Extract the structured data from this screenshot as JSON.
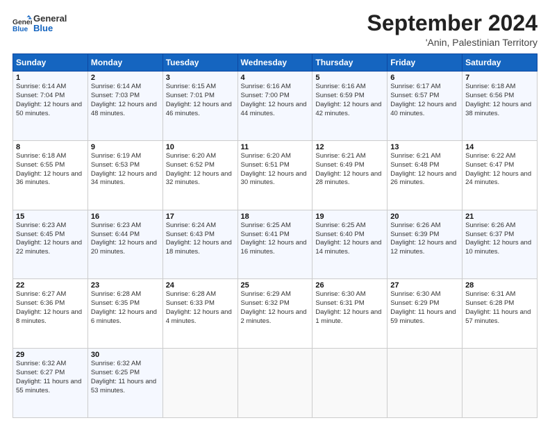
{
  "header": {
    "logo_line1": "General",
    "logo_line2": "Blue",
    "month": "September 2024",
    "location": "'Anin, Palestinian Territory"
  },
  "weekdays": [
    "Sunday",
    "Monday",
    "Tuesday",
    "Wednesday",
    "Thursday",
    "Friday",
    "Saturday"
  ],
  "weeks": [
    [
      {
        "day": "1",
        "sunrise": "Sunrise: 6:14 AM",
        "sunset": "Sunset: 7:04 PM",
        "daylight": "Daylight: 12 hours and 50 minutes."
      },
      {
        "day": "2",
        "sunrise": "Sunrise: 6:14 AM",
        "sunset": "Sunset: 7:03 PM",
        "daylight": "Daylight: 12 hours and 48 minutes."
      },
      {
        "day": "3",
        "sunrise": "Sunrise: 6:15 AM",
        "sunset": "Sunset: 7:01 PM",
        "daylight": "Daylight: 12 hours and 46 minutes."
      },
      {
        "day": "4",
        "sunrise": "Sunrise: 6:16 AM",
        "sunset": "Sunset: 7:00 PM",
        "daylight": "Daylight: 12 hours and 44 minutes."
      },
      {
        "day": "5",
        "sunrise": "Sunrise: 6:16 AM",
        "sunset": "Sunset: 6:59 PM",
        "daylight": "Daylight: 12 hours and 42 minutes."
      },
      {
        "day": "6",
        "sunrise": "Sunrise: 6:17 AM",
        "sunset": "Sunset: 6:57 PM",
        "daylight": "Daylight: 12 hours and 40 minutes."
      },
      {
        "day": "7",
        "sunrise": "Sunrise: 6:18 AM",
        "sunset": "Sunset: 6:56 PM",
        "daylight": "Daylight: 12 hours and 38 minutes."
      }
    ],
    [
      {
        "day": "8",
        "sunrise": "Sunrise: 6:18 AM",
        "sunset": "Sunset: 6:55 PM",
        "daylight": "Daylight: 12 hours and 36 minutes."
      },
      {
        "day": "9",
        "sunrise": "Sunrise: 6:19 AM",
        "sunset": "Sunset: 6:53 PM",
        "daylight": "Daylight: 12 hours and 34 minutes."
      },
      {
        "day": "10",
        "sunrise": "Sunrise: 6:20 AM",
        "sunset": "Sunset: 6:52 PM",
        "daylight": "Daylight: 12 hours and 32 minutes."
      },
      {
        "day": "11",
        "sunrise": "Sunrise: 6:20 AM",
        "sunset": "Sunset: 6:51 PM",
        "daylight": "Daylight: 12 hours and 30 minutes."
      },
      {
        "day": "12",
        "sunrise": "Sunrise: 6:21 AM",
        "sunset": "Sunset: 6:49 PM",
        "daylight": "Daylight: 12 hours and 28 minutes."
      },
      {
        "day": "13",
        "sunrise": "Sunrise: 6:21 AM",
        "sunset": "Sunset: 6:48 PM",
        "daylight": "Daylight: 12 hours and 26 minutes."
      },
      {
        "day": "14",
        "sunrise": "Sunrise: 6:22 AM",
        "sunset": "Sunset: 6:47 PM",
        "daylight": "Daylight: 12 hours and 24 minutes."
      }
    ],
    [
      {
        "day": "15",
        "sunrise": "Sunrise: 6:23 AM",
        "sunset": "Sunset: 6:45 PM",
        "daylight": "Daylight: 12 hours and 22 minutes."
      },
      {
        "day": "16",
        "sunrise": "Sunrise: 6:23 AM",
        "sunset": "Sunset: 6:44 PM",
        "daylight": "Daylight: 12 hours and 20 minutes."
      },
      {
        "day": "17",
        "sunrise": "Sunrise: 6:24 AM",
        "sunset": "Sunset: 6:43 PM",
        "daylight": "Daylight: 12 hours and 18 minutes."
      },
      {
        "day": "18",
        "sunrise": "Sunrise: 6:25 AM",
        "sunset": "Sunset: 6:41 PM",
        "daylight": "Daylight: 12 hours and 16 minutes."
      },
      {
        "day": "19",
        "sunrise": "Sunrise: 6:25 AM",
        "sunset": "Sunset: 6:40 PM",
        "daylight": "Daylight: 12 hours and 14 minutes."
      },
      {
        "day": "20",
        "sunrise": "Sunrise: 6:26 AM",
        "sunset": "Sunset: 6:39 PM",
        "daylight": "Daylight: 12 hours and 12 minutes."
      },
      {
        "day": "21",
        "sunrise": "Sunrise: 6:26 AM",
        "sunset": "Sunset: 6:37 PM",
        "daylight": "Daylight: 12 hours and 10 minutes."
      }
    ],
    [
      {
        "day": "22",
        "sunrise": "Sunrise: 6:27 AM",
        "sunset": "Sunset: 6:36 PM",
        "daylight": "Daylight: 12 hours and 8 minutes."
      },
      {
        "day": "23",
        "sunrise": "Sunrise: 6:28 AM",
        "sunset": "Sunset: 6:35 PM",
        "daylight": "Daylight: 12 hours and 6 minutes."
      },
      {
        "day": "24",
        "sunrise": "Sunrise: 6:28 AM",
        "sunset": "Sunset: 6:33 PM",
        "daylight": "Daylight: 12 hours and 4 minutes."
      },
      {
        "day": "25",
        "sunrise": "Sunrise: 6:29 AM",
        "sunset": "Sunset: 6:32 PM",
        "daylight": "Daylight: 12 hours and 2 minutes."
      },
      {
        "day": "26",
        "sunrise": "Sunrise: 6:30 AM",
        "sunset": "Sunset: 6:31 PM",
        "daylight": "Daylight: 12 hours and 1 minute."
      },
      {
        "day": "27",
        "sunrise": "Sunrise: 6:30 AM",
        "sunset": "Sunset: 6:29 PM",
        "daylight": "Daylight: 11 hours and 59 minutes."
      },
      {
        "day": "28",
        "sunrise": "Sunrise: 6:31 AM",
        "sunset": "Sunset: 6:28 PM",
        "daylight": "Daylight: 11 hours and 57 minutes."
      }
    ],
    [
      {
        "day": "29",
        "sunrise": "Sunrise: 6:32 AM",
        "sunset": "Sunset: 6:27 PM",
        "daylight": "Daylight: 11 hours and 55 minutes."
      },
      {
        "day": "30",
        "sunrise": "Sunrise: 6:32 AM",
        "sunset": "Sunset: 6:25 PM",
        "daylight": "Daylight: 11 hours and 53 minutes."
      },
      null,
      null,
      null,
      null,
      null
    ]
  ]
}
